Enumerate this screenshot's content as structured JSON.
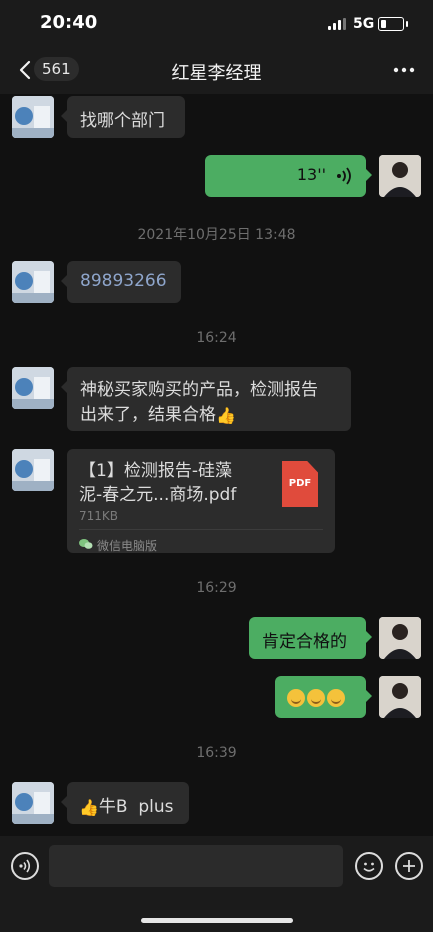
{
  "status_bar": {
    "time": "20:40",
    "network": "5G"
  },
  "header": {
    "unread_count": "561",
    "title": "红星李经理"
  },
  "messages": [
    {
      "side": "left",
      "text": "找哪个部门"
    },
    {
      "side": "right",
      "voice_duration": "13''"
    },
    {
      "timestamp": "2021年10月25日 13:48"
    },
    {
      "side": "left",
      "text": "89893266"
    },
    {
      "timestamp": "16:24"
    },
    {
      "side": "left",
      "text_line1": "神秘买家购买的产品，检测报告",
      "text_line2": "出来了，结果合格",
      "emoji": "thumbs-up"
    },
    {
      "side": "left",
      "file": {
        "name_line1": "【1】检测报告-硅藻",
        "name_line2": "泥-春之元...商场.pdf",
        "size": "711KB",
        "source": "微信电脑版",
        "icon_label": "PDF"
      }
    },
    {
      "timestamp": "16:29"
    },
    {
      "side": "right",
      "text": "肯定合格的"
    },
    {
      "side": "right",
      "emoji": "face-emoji",
      "count": 3
    },
    {
      "timestamp": "16:39"
    },
    {
      "side": "left",
      "emoji": "thumbs-up",
      "text": "牛B  plus"
    }
  ],
  "colors": {
    "my_bubble": "#4cad62",
    "their_bubble": "#2c2c2c",
    "background": "#111111",
    "pdf_icon": "#e04b3c"
  }
}
